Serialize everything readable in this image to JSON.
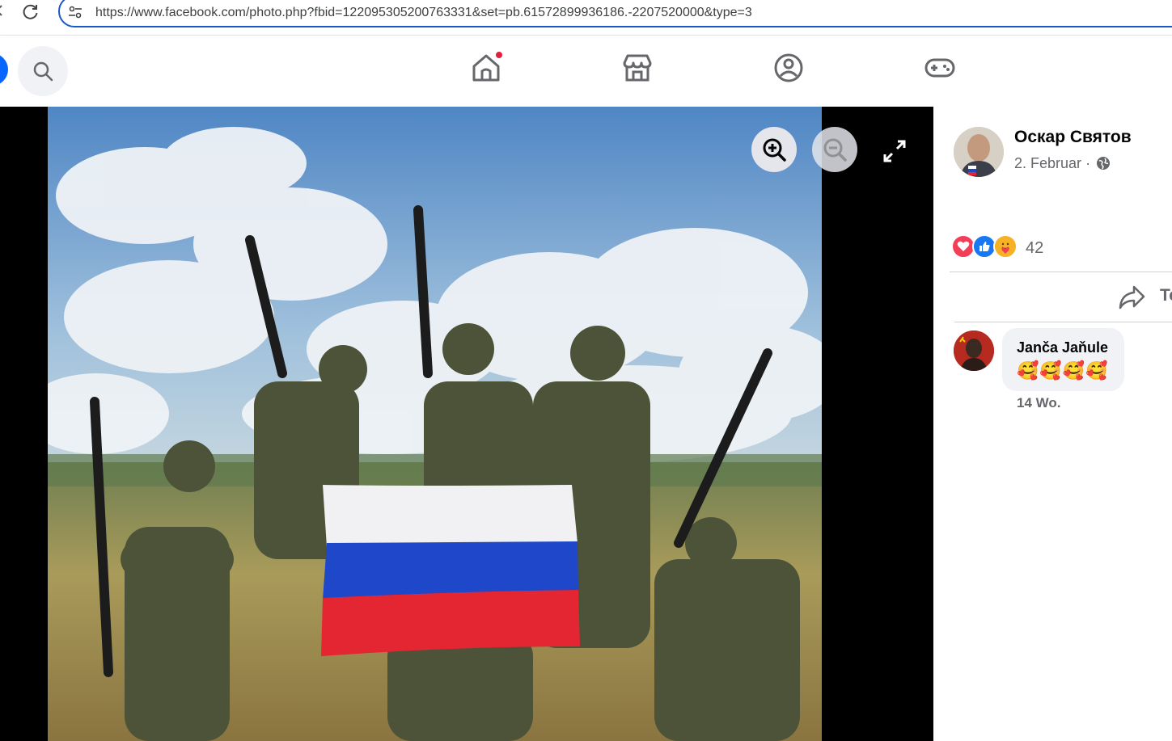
{
  "browser": {
    "url": "https://www.facebook.com/photo.php?fbid=122095305200763331&set=pb.61572899936186.-2207520000&type=3"
  },
  "header": {
    "icons": [
      "search-icon",
      "home-icon",
      "marketplace-icon",
      "groups-icon",
      "gaming-icon"
    ],
    "home_has_notification": true
  },
  "viewer": {
    "photo_description_icon": "photo",
    "controls": [
      "zoom-in-icon",
      "zoom-out-icon",
      "fullscreen-icon"
    ]
  },
  "post": {
    "author": "Оскар Святов",
    "date": "2. Februar",
    "date_separator": "·",
    "privacy_icon": "globe-icon",
    "reactions": [
      "love",
      "like",
      "care"
    ],
    "reaction_count": "42",
    "share_label": "Te"
  },
  "comments": [
    {
      "author": "Janča Jaňule",
      "text": "🥰🥰🥰🥰",
      "time": "14 Wo."
    }
  ],
  "colors": {
    "accent": "#0866ff",
    "notification": "#e41e3f",
    "love": "#f33e58",
    "like": "#1877f2",
    "care": "#f7b125"
  }
}
